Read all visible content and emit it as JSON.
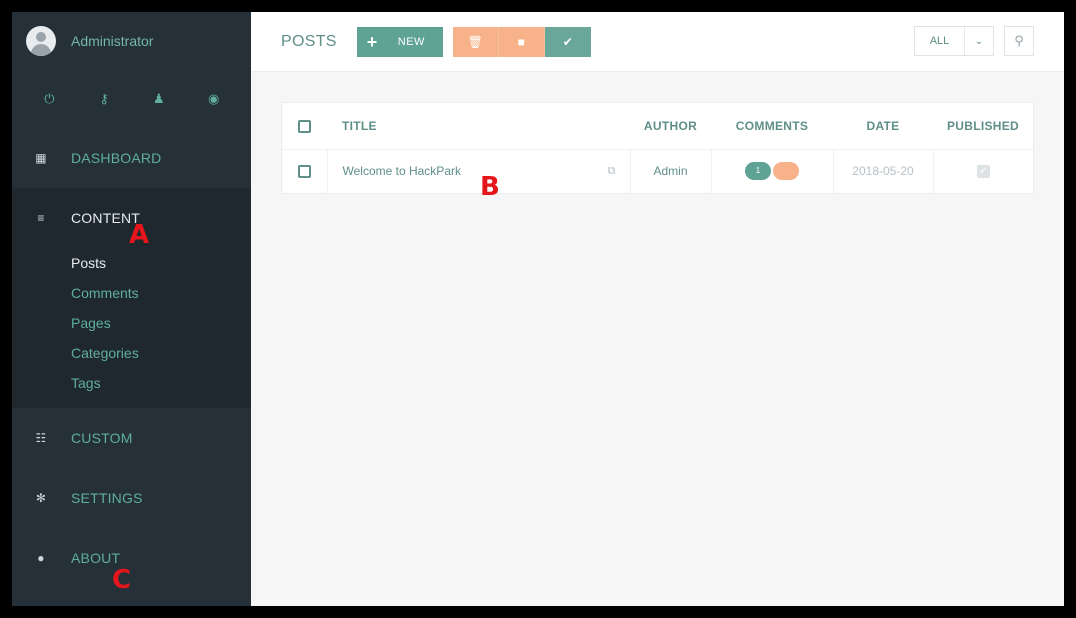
{
  "sidebar": {
    "user_name": "Administrator",
    "quick_icons": [
      "power-icon",
      "key-icon",
      "user-icon",
      "globe-icon"
    ],
    "nav": {
      "dashboard": "DASHBOARD",
      "content": "CONTENT",
      "custom": "CUSTOM",
      "settings": "SETTINGS",
      "about": "ABOUT"
    },
    "content_items": [
      "Posts",
      "Comments",
      "Pages",
      "Categories",
      "Tags"
    ]
  },
  "markers": {
    "a": "A",
    "b": "B",
    "c": "C"
  },
  "toolbar": {
    "title": "POSTS",
    "new_label": "NEW",
    "filter_label": "ALL"
  },
  "table": {
    "headers": [
      "TITLE",
      "AUTHOR",
      "COMMENTS",
      "DATE",
      "PUBLISHED"
    ],
    "rows": [
      {
        "title": "Welcome to HackPark",
        "author": "Admin",
        "comments_count": "1",
        "date": "2018-05-20"
      }
    ]
  },
  "colors": {
    "sidebar_bg": "#263039",
    "accent_green": "#5fa394",
    "accent_orange": "#f7b28a",
    "marker_red": "#e5161b"
  }
}
